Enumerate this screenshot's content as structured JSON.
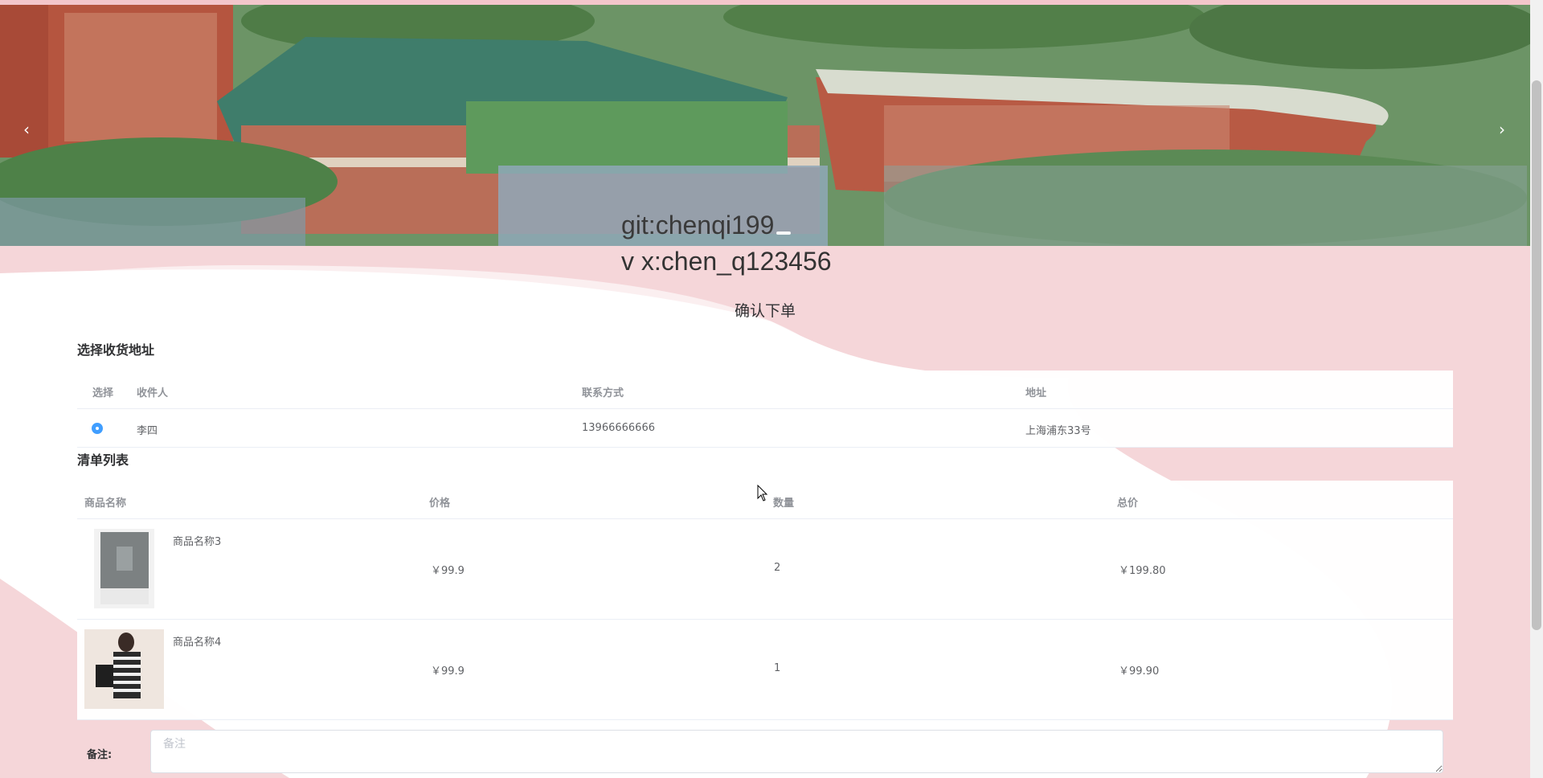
{
  "watermark": {
    "line1": "git:chenqi199",
    "line2": "v x:chen_q123456"
  },
  "carousel": {
    "prev_icon": "chevron-left-icon",
    "next_icon": "chevron-right-icon",
    "prev_label": "‹",
    "next_label": "›"
  },
  "page": {
    "title": "确认下单"
  },
  "address_section": {
    "title": "选择收货地址",
    "headers": {
      "select": "选择",
      "receiver": "收件人",
      "contact": "联系方式",
      "address": "地址"
    },
    "rows": [
      {
        "selected": true,
        "receiver": "李四",
        "contact": "13966666666",
        "address": "上海浦东33号"
      }
    ]
  },
  "list_section": {
    "title": "清单列表",
    "headers": {
      "name": "商品名称",
      "price": "价格",
      "quantity": "数量",
      "total": "总价"
    },
    "rows": [
      {
        "name": "商品名称3",
        "price": "￥99.9",
        "quantity": "2",
        "total": "￥199.80",
        "image": "book-cover-image"
      },
      {
        "name": "商品名称4",
        "price": "￥99.9",
        "quantity": "1",
        "total": "￥99.90",
        "image": "dress-photo-image"
      }
    ]
  },
  "remark": {
    "label": "备注:",
    "placeholder": "备注",
    "value": ""
  },
  "colors": {
    "accent": "#409eff",
    "pink_bg": "#f3c6cb"
  }
}
